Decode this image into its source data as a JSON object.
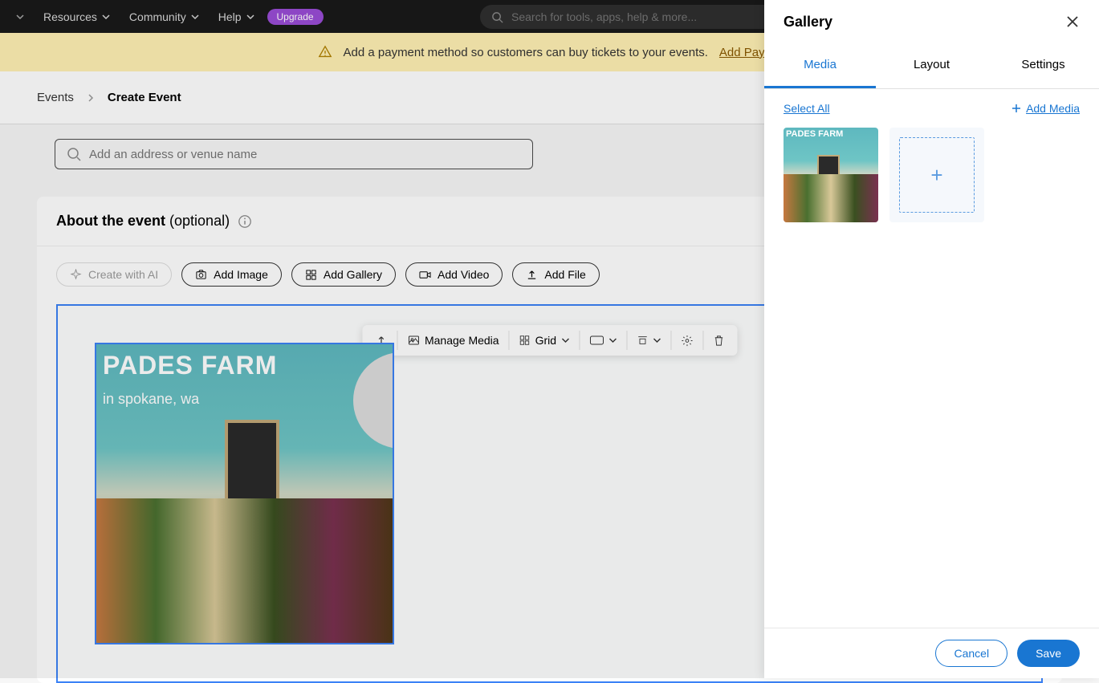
{
  "topnav": {
    "items": [
      "Resources",
      "Community",
      "Help"
    ],
    "upgrade": "Upgrade",
    "search_placeholder": "Search for tools, apps, help & more..."
  },
  "banner": {
    "text": "Add a payment method so customers can buy tickets to your events.",
    "link": "Add Payme"
  },
  "breadcrumb": {
    "root": "Events",
    "current": "Create Event"
  },
  "address": {
    "placeholder": "Add an address or venue name"
  },
  "about": {
    "title": "About the event",
    "optional": "(optional)"
  },
  "pills": {
    "ai": "Create with AI",
    "image": "Add Image",
    "gallery": "Add Gallery",
    "video": "Add Video",
    "file": "Add File"
  },
  "toolbar": {
    "manage": "Manage Media",
    "grid": "Grid"
  },
  "panel": {
    "title": "Gallery",
    "tabs": [
      "Media",
      "Layout",
      "Settings"
    ],
    "select_all": "Select All",
    "add_media": "Add Media",
    "cancel": "Cancel",
    "save": "Save"
  }
}
